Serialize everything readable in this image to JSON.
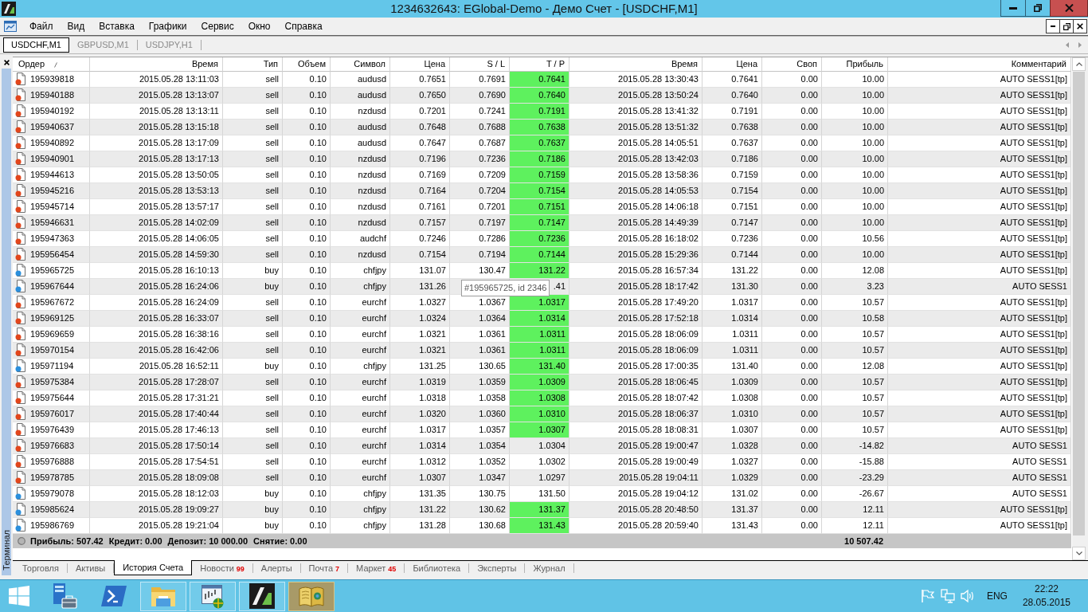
{
  "window": {
    "title": "1234632643: EGlobal-Demo - Демо Счет - [USDCHF,M1]"
  },
  "menu": [
    "Файл",
    "Вид",
    "Вставка",
    "Графики",
    "Сервис",
    "Окно",
    "Справка"
  ],
  "chart_tabs": [
    {
      "label": "USDCHF,M1",
      "selected": true
    },
    {
      "label": "GBPUSD,M1",
      "selected": false
    },
    {
      "label": "USDJPY,H1",
      "selected": false
    }
  ],
  "terminal": {
    "title": "Терминал",
    "table": {
      "columns": [
        {
          "label": "Ордер",
          "sorted": true
        },
        {
          "label": "Время",
          "sorted": false
        },
        {
          "label": "Тип",
          "sorted": false
        },
        {
          "label": "Объем",
          "sorted": false
        },
        {
          "label": "Символ",
          "sorted": false
        },
        {
          "label": "Цена",
          "sorted": false
        },
        {
          "label": "S / L",
          "sorted": false
        },
        {
          "label": "T / P",
          "sorted": false
        },
        {
          "label": "Время",
          "sorted": false
        },
        {
          "label": "Цена",
          "sorted": false
        },
        {
          "label": "Своп",
          "sorted": false
        },
        {
          "label": "Прибыль",
          "sorted": false
        },
        {
          "label": "Комментарий",
          "sorted": false
        }
      ],
      "rows": [
        {
          "order": "195939818",
          "open_time": "2015.05.28 13:11:03",
          "type": "sell",
          "volume": "0.10",
          "symbol": "audusd",
          "open_price": "0.7651",
          "sl": "0.7691",
          "tp": "0.7641",
          "tp_hit": true,
          "close_time": "2015.05.28 13:30:43",
          "close_price": "0.7641",
          "swap": "0.00",
          "profit": "10.00",
          "comment": "AUTO SESS1[tp]",
          "color": "#e2461c"
        },
        {
          "order": "195940188",
          "open_time": "2015.05.28 13:13:07",
          "type": "sell",
          "volume": "0.10",
          "symbol": "audusd",
          "open_price": "0.7650",
          "sl": "0.7690",
          "tp": "0.7640",
          "tp_hit": true,
          "close_time": "2015.05.28 13:50:24",
          "close_price": "0.7640",
          "swap": "0.00",
          "profit": "10.00",
          "comment": "AUTO SESS1[tp]",
          "color": "#e2461c"
        },
        {
          "order": "195940192",
          "open_time": "2015.05.28 13:13:11",
          "type": "sell",
          "volume": "0.10",
          "symbol": "nzdusd",
          "open_price": "0.7201",
          "sl": "0.7241",
          "tp": "0.7191",
          "tp_hit": true,
          "close_time": "2015.05.28 13:41:32",
          "close_price": "0.7191",
          "swap": "0.00",
          "profit": "10.00",
          "comment": "AUTO SESS1[tp]",
          "color": "#e2461c"
        },
        {
          "order": "195940637",
          "open_time": "2015.05.28 13:15:18",
          "type": "sell",
          "volume": "0.10",
          "symbol": "audusd",
          "open_price": "0.7648",
          "sl": "0.7688",
          "tp": "0.7638",
          "tp_hit": true,
          "close_time": "2015.05.28 13:51:32",
          "close_price": "0.7638",
          "swap": "0.00",
          "profit": "10.00",
          "comment": "AUTO SESS1[tp]",
          "color": "#e2461c"
        },
        {
          "order": "195940892",
          "open_time": "2015.05.28 13:17:09",
          "type": "sell",
          "volume": "0.10",
          "symbol": "audusd",
          "open_price": "0.7647",
          "sl": "0.7687",
          "tp": "0.7637",
          "tp_hit": true,
          "close_time": "2015.05.28 14:05:51",
          "close_price": "0.7637",
          "swap": "0.00",
          "profit": "10.00",
          "comment": "AUTO SESS1[tp]",
          "color": "#e2461c"
        },
        {
          "order": "195940901",
          "open_time": "2015.05.28 13:17:13",
          "type": "sell",
          "volume": "0.10",
          "symbol": "nzdusd",
          "open_price": "0.7196",
          "sl": "0.7236",
          "tp": "0.7186",
          "tp_hit": true,
          "close_time": "2015.05.28 13:42:03",
          "close_price": "0.7186",
          "swap": "0.00",
          "profit": "10.00",
          "comment": "AUTO SESS1[tp]",
          "color": "#e2461c"
        },
        {
          "order": "195944613",
          "open_time": "2015.05.28 13:50:05",
          "type": "sell",
          "volume": "0.10",
          "symbol": "nzdusd",
          "open_price": "0.7169",
          "sl": "0.7209",
          "tp": "0.7159",
          "tp_hit": true,
          "close_time": "2015.05.28 13:58:36",
          "close_price": "0.7159",
          "swap": "0.00",
          "profit": "10.00",
          "comment": "AUTO SESS1[tp]",
          "color": "#e2461c"
        },
        {
          "order": "195945216",
          "open_time": "2015.05.28 13:53:13",
          "type": "sell",
          "volume": "0.10",
          "symbol": "nzdusd",
          "open_price": "0.7164",
          "sl": "0.7204",
          "tp": "0.7154",
          "tp_hit": true,
          "close_time": "2015.05.28 14:05:53",
          "close_price": "0.7154",
          "swap": "0.00",
          "profit": "10.00",
          "comment": "AUTO SESS1[tp]",
          "color": "#e2461c"
        },
        {
          "order": "195945714",
          "open_time": "2015.05.28 13:57:17",
          "type": "sell",
          "volume": "0.10",
          "symbol": "nzdusd",
          "open_price": "0.7161",
          "sl": "0.7201",
          "tp": "0.7151",
          "tp_hit": true,
          "close_time": "2015.05.28 14:06:18",
          "close_price": "0.7151",
          "swap": "0.00",
          "profit": "10.00",
          "comment": "AUTO SESS1[tp]",
          "color": "#e2461c"
        },
        {
          "order": "195946631",
          "open_time": "2015.05.28 14:02:09",
          "type": "sell",
          "volume": "0.10",
          "symbol": "nzdusd",
          "open_price": "0.7157",
          "sl": "0.7197",
          "tp": "0.7147",
          "tp_hit": true,
          "close_time": "2015.05.28 14:49:39",
          "close_price": "0.7147",
          "swap": "0.00",
          "profit": "10.00",
          "comment": "AUTO SESS1[tp]",
          "color": "#e2461c"
        },
        {
          "order": "195947363",
          "open_time": "2015.05.28 14:06:05",
          "type": "sell",
          "volume": "0.10",
          "symbol": "audchf",
          "open_price": "0.7246",
          "sl": "0.7286",
          "tp": "0.7236",
          "tp_hit": true,
          "close_time": "2015.05.28 16:18:02",
          "close_price": "0.7236",
          "swap": "0.00",
          "profit": "10.56",
          "comment": "AUTO SESS1[tp]",
          "color": "#e2461c"
        },
        {
          "order": "195956454",
          "open_time": "2015.05.28 14:59:30",
          "type": "sell",
          "volume": "0.10",
          "symbol": "nzdusd",
          "open_price": "0.7154",
          "sl": "0.7194",
          "tp": "0.7144",
          "tp_hit": true,
          "close_time": "2015.05.28 15:29:36",
          "close_price": "0.7144",
          "swap": "0.00",
          "profit": "10.00",
          "comment": "AUTO SESS1[tp]",
          "color": "#e2461c"
        },
        {
          "order": "195965725",
          "open_time": "2015.05.28 16:10:13",
          "type": "buy",
          "volume": "0.10",
          "symbol": "chfjpy",
          "open_price": "131.07",
          "sl": "130.47",
          "tp": "131.22",
          "tp_hit": true,
          "close_time": "2015.05.28 16:57:34",
          "close_price": "131.22",
          "swap": "0.00",
          "profit": "12.08",
          "comment": "AUTO SESS1[tp]",
          "color": "#2b8fdc"
        },
        {
          "order": "195967644",
          "open_time": "2015.05.28 16:24:06",
          "type": "buy",
          "volume": "0.10",
          "symbol": "chfjpy",
          "open_price": "131.26",
          "tp": ".41",
          "tp_hit": false,
          "close_time": "2015.05.28 18:17:42",
          "close_price": "131.30",
          "swap": "0.00",
          "profit": "3.23",
          "comment": "AUTO SESS1",
          "color": "#2b8fdc"
        },
        {
          "order": "195967672",
          "open_time": "2015.05.28 16:24:09",
          "type": "sell",
          "volume": "0.10",
          "symbol": "eurchf",
          "open_price": "1.0327",
          "sl": "1.0367",
          "tp": "1.0317",
          "tp_hit": true,
          "close_time": "2015.05.28 17:49:20",
          "close_price": "1.0317",
          "swap": "0.00",
          "profit": "10.57",
          "comment": "AUTO SESS1[tp]",
          "color": "#e2461c"
        },
        {
          "order": "195969125",
          "open_time": "2015.05.28 16:33:07",
          "type": "sell",
          "volume": "0.10",
          "symbol": "eurchf",
          "open_price": "1.0324",
          "sl": "1.0364",
          "tp": "1.0314",
          "tp_hit": true,
          "close_time": "2015.05.28 17:52:18",
          "close_price": "1.0314",
          "swap": "0.00",
          "profit": "10.58",
          "comment": "AUTO SESS1[tp]",
          "color": "#e2461c"
        },
        {
          "order": "195969659",
          "open_time": "2015.05.28 16:38:16",
          "type": "sell",
          "volume": "0.10",
          "symbol": "eurchf",
          "open_price": "1.0321",
          "sl": "1.0361",
          "tp": "1.0311",
          "tp_hit": true,
          "close_time": "2015.05.28 18:06:09",
          "close_price": "1.0311",
          "swap": "0.00",
          "profit": "10.57",
          "comment": "AUTO SESS1[tp]",
          "color": "#e2461c"
        },
        {
          "order": "195970154",
          "open_time": "2015.05.28 16:42:06",
          "type": "sell",
          "volume": "0.10",
          "symbol": "eurchf",
          "open_price": "1.0321",
          "sl": "1.0361",
          "tp": "1.0311",
          "tp_hit": true,
          "close_time": "2015.05.28 18:06:09",
          "close_price": "1.0311",
          "swap": "0.00",
          "profit": "10.57",
          "comment": "AUTO SESS1[tp]",
          "color": "#e2461c"
        },
        {
          "order": "195971194",
          "open_time": "2015.05.28 16:52:11",
          "type": "buy",
          "volume": "0.10",
          "symbol": "chfjpy",
          "open_price": "131.25",
          "sl": "130.65",
          "tp": "131.40",
          "tp_hit": true,
          "close_time": "2015.05.28 17:00:35",
          "close_price": "131.40",
          "swap": "0.00",
          "profit": "12.08",
          "comment": "AUTO SESS1[tp]",
          "color": "#2b8fdc"
        },
        {
          "order": "195975384",
          "open_time": "2015.05.28 17:28:07",
          "type": "sell",
          "volume": "0.10",
          "symbol": "eurchf",
          "open_price": "1.0319",
          "sl": "1.0359",
          "tp": "1.0309",
          "tp_hit": true,
          "close_time": "2015.05.28 18:06:45",
          "close_price": "1.0309",
          "swap": "0.00",
          "profit": "10.57",
          "comment": "AUTO SESS1[tp]",
          "color": "#e2461c"
        },
        {
          "order": "195975644",
          "open_time": "2015.05.28 17:31:21",
          "type": "sell",
          "volume": "0.10",
          "symbol": "eurchf",
          "open_price": "1.0318",
          "sl": "1.0358",
          "tp": "1.0308",
          "tp_hit": true,
          "close_time": "2015.05.28 18:07:42",
          "close_price": "1.0308",
          "swap": "0.00",
          "profit": "10.57",
          "comment": "AUTO SESS1[tp]",
          "color": "#e2461c"
        },
        {
          "order": "195976017",
          "open_time": "2015.05.28 17:40:44",
          "type": "sell",
          "volume": "0.10",
          "symbol": "eurchf",
          "open_price": "1.0320",
          "sl": "1.0360",
          "tp": "1.0310",
          "tp_hit": true,
          "close_time": "2015.05.28 18:06:37",
          "close_price": "1.0310",
          "swap": "0.00",
          "profit": "10.57",
          "comment": "AUTO SESS1[tp]",
          "color": "#e2461c"
        },
        {
          "order": "195976439",
          "open_time": "2015.05.28 17:46:13",
          "type": "sell",
          "volume": "0.10",
          "symbol": "eurchf",
          "open_price": "1.0317",
          "sl": "1.0357",
          "tp": "1.0307",
          "tp_hit": true,
          "close_time": "2015.05.28 18:08:31",
          "close_price": "1.0307",
          "swap": "0.00",
          "profit": "10.57",
          "comment": "AUTO SESS1[tp]",
          "color": "#e2461c"
        },
        {
          "order": "195976683",
          "open_time": "2015.05.28 17:50:14",
          "type": "sell",
          "volume": "0.10",
          "symbol": "eurchf",
          "open_price": "1.0314",
          "sl": "1.0354",
          "tp": "1.0304",
          "tp_hit": false,
          "close_time": "2015.05.28 19:00:47",
          "close_price": "1.0328",
          "swap": "0.00",
          "profit": "-14.82",
          "comment": "AUTO SESS1",
          "color": "#e2461c"
        },
        {
          "order": "195976888",
          "open_time": "2015.05.28 17:54:51",
          "type": "sell",
          "volume": "0.10",
          "symbol": "eurchf",
          "open_price": "1.0312",
          "sl": "1.0352",
          "tp": "1.0302",
          "tp_hit": false,
          "close_time": "2015.05.28 19:00:49",
          "close_price": "1.0327",
          "swap": "0.00",
          "profit": "-15.88",
          "comment": "AUTO SESS1",
          "color": "#e2461c"
        },
        {
          "order": "195978785",
          "open_time": "2015.05.28 18:09:08",
          "type": "sell",
          "volume": "0.10",
          "symbol": "eurchf",
          "open_price": "1.0307",
          "sl": "1.0347",
          "tp": "1.0297",
          "tp_hit": false,
          "close_time": "2015.05.28 19:04:11",
          "close_price": "1.0329",
          "swap": "0.00",
          "profit": "-23.29",
          "comment": "AUTO SESS1",
          "color": "#e2461c"
        },
        {
          "order": "195979078",
          "open_time": "2015.05.28 18:12:03",
          "type": "buy",
          "volume": "0.10",
          "symbol": "chfjpy",
          "open_price": "131.35",
          "sl": "130.75",
          "tp": "131.50",
          "tp_hit": false,
          "close_time": "2015.05.28 19:04:12",
          "close_price": "131.02",
          "swap": "0.00",
          "profit": "-26.67",
          "comment": "AUTO SESS1",
          "color": "#2b8fdc"
        },
        {
          "order": "195985624",
          "open_time": "2015.05.28 19:09:27",
          "type": "buy",
          "volume": "0.10",
          "symbol": "chfjpy",
          "open_price": "131.22",
          "sl": "130.62",
          "tp": "131.37",
          "tp_hit": true,
          "close_time": "2015.05.28 20:48:50",
          "close_price": "131.37",
          "swap": "0.00",
          "profit": "12.11",
          "comment": "AUTO SESS1[tp]",
          "color": "#2b8fdc"
        },
        {
          "order": "195986769",
          "open_time": "2015.05.28 19:21:04",
          "type": "buy",
          "volume": "0.10",
          "symbol": "chfjpy",
          "open_price": "131.28",
          "sl": "130.68",
          "tp": "131.43",
          "tp_hit": true,
          "close_time": "2015.05.28 20:59:40",
          "close_price": "131.43",
          "swap": "0.00",
          "profit": "12.11",
          "comment": "AUTO SESS1[tp]",
          "color": "#2b8fdc"
        }
      ]
    },
    "summary": {
      "items": [
        "Прибыль: 507.42",
        "Кредит: 0.00",
        "Депозит: 10 000.00",
        "Снятие: 0.00"
      ],
      "total": "10 507.42"
    },
    "tooltip": "#195965725, id 2346",
    "tabs": [
      {
        "label": "Торговля",
        "selected": false
      },
      {
        "label": "Активы",
        "selected": false
      },
      {
        "label": "История Счета",
        "selected": true
      },
      {
        "label": "Новости",
        "badge": "99",
        "selected": false
      },
      {
        "label": "Алерты",
        "selected": false
      },
      {
        "label": "Почта",
        "badge": "7",
        "selected": false
      },
      {
        "label": "Маркет",
        "badge": "45",
        "selected": false
      },
      {
        "label": "Библиотека",
        "selected": false
      },
      {
        "label": "Эксперты",
        "selected": false
      },
      {
        "label": "Журнал",
        "selected": false
      }
    ]
  },
  "taskbar": {
    "buttons": [
      {
        "kind": "start",
        "running": false,
        "selected": false
      },
      {
        "kind": "servers",
        "running": false,
        "selected": false
      },
      {
        "kind": "shell",
        "running": false,
        "selected": false
      },
      {
        "kind": "folder",
        "running": true,
        "selected": false
      },
      {
        "kind": "chart",
        "running": true,
        "selected": false
      },
      {
        "kind": "logo",
        "running": true,
        "selected": false
      },
      {
        "kind": "book",
        "running": true,
        "selected": true
      }
    ],
    "language": "ENG",
    "time": "22:22",
    "date": "28.05.2015"
  }
}
